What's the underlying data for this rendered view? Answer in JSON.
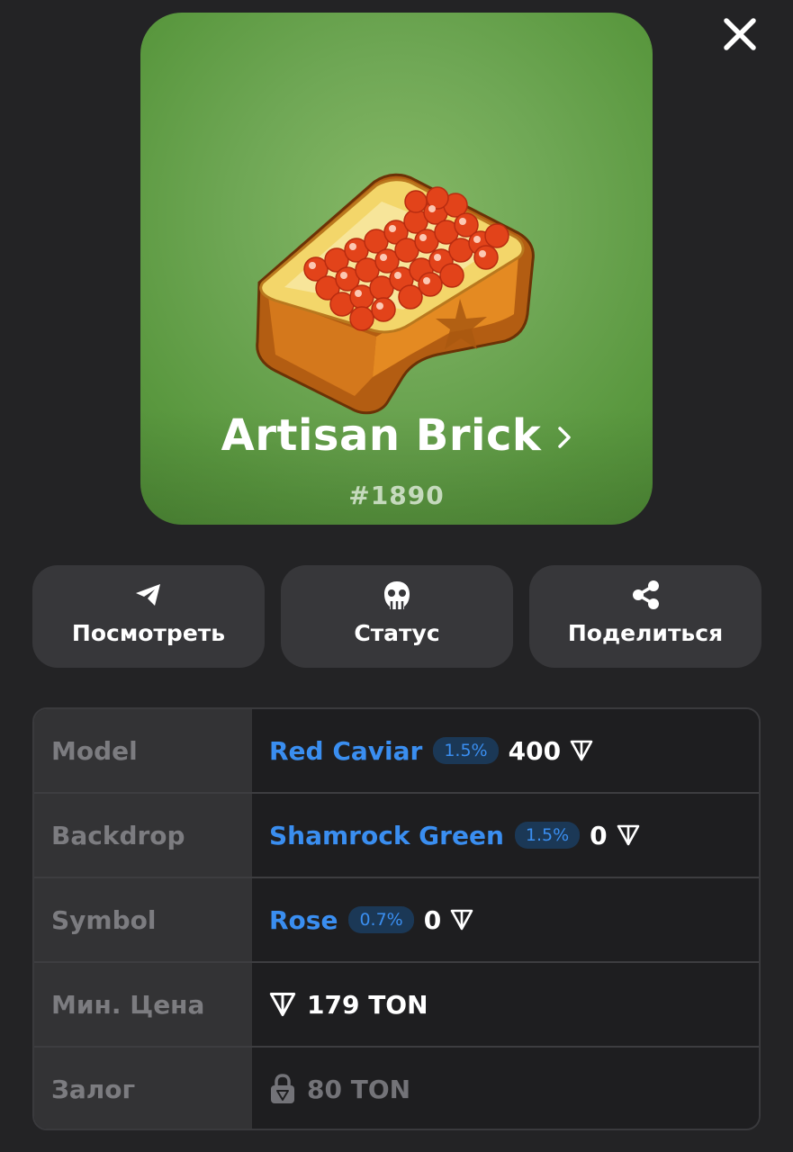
{
  "header": {
    "close_icon": "close-icon"
  },
  "gift": {
    "title": "Artisan Brick",
    "number": "#1890",
    "backdrop_color": "#6fa755",
    "art": "red-caviar-bread-icon"
  },
  "actions": [
    {
      "label": "Посмотреть",
      "icon": "telegram-plane-icon"
    },
    {
      "label": "Статус",
      "icon": "status-icon"
    },
    {
      "label": "Поделиться",
      "icon": "share-icon"
    }
  ],
  "details": {
    "model": {
      "label": "Model",
      "value": "Red Caviar",
      "rarity": "1.5%",
      "price": "400",
      "currency_icon": "ton-icon"
    },
    "backdrop": {
      "label": "Backdrop",
      "value": "Shamrock Green",
      "rarity": "1.5%",
      "price": "0",
      "currency_icon": "ton-icon"
    },
    "symbol": {
      "label": "Symbol",
      "value": "Rose",
      "rarity": "0.7%",
      "price": "0",
      "currency_icon": "ton-icon"
    },
    "min_price": {
      "label": "Мин. Цена",
      "value": "179 TON",
      "currency_icon": "ton-icon"
    },
    "deposit": {
      "label": "Залог",
      "value": "80 TON",
      "lock_icon": "lock-icon"
    }
  },
  "colors": {
    "background": "#232325",
    "link": "#3a8ef0",
    "badge_bg": "#1b3856",
    "button_bg": "#37373a"
  }
}
